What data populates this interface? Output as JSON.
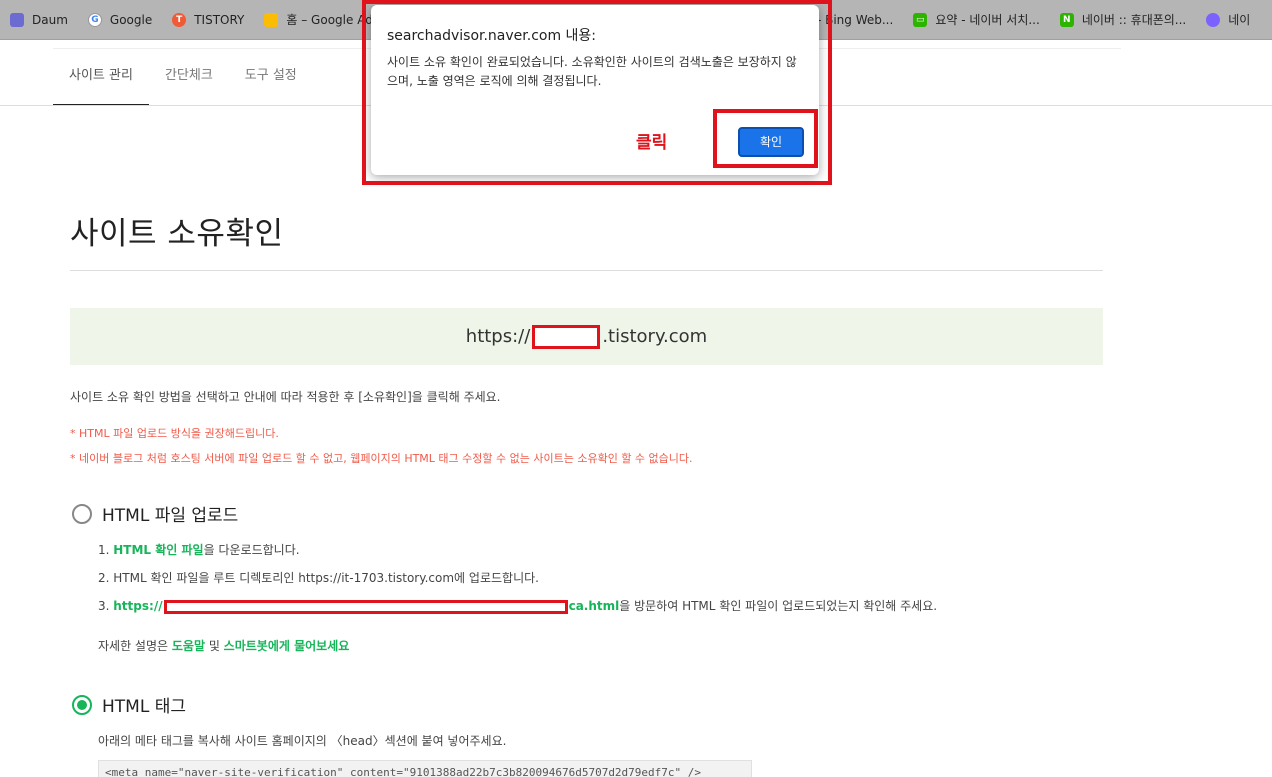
{
  "bookmarks": [
    {
      "label": "Daum",
      "icon": "daum-icon",
      "color": "#6b6bd1"
    },
    {
      "label": "Google",
      "icon": "google-icon",
      "color": "#4285f4"
    },
    {
      "label": "TISTORY",
      "icon": "tistory-icon",
      "color": "#f05a36"
    },
    {
      "label": "홈 – Google Ads",
      "icon": "google-ads-icon",
      "color": "#fbbc04"
    },
    {
      "label": "me - Bing Web...",
      "icon": "bing-icon",
      "color": "#9e9e9e"
    },
    {
      "label": "요약 - 네이버 서치...",
      "icon": "naver-search-icon",
      "color": "#2db400"
    },
    {
      "label": "네이버 :: 휴대폰의...",
      "icon": "naver-icon",
      "color": "#2db400"
    },
    {
      "label": "네이",
      "icon": "erp-icon",
      "color": "#7b61ff"
    }
  ],
  "tabs": [
    "사이트 관리",
    "간단체크",
    "도구 설정"
  ],
  "page": {
    "title": "사이트 소유확인",
    "url_prefix": "https://",
    "url_suffix": ".tistory.com",
    "desc": "사이트 소유 확인 방법을 선택하고 안내에 따라 적용한 후 [소유확인]을 클릭해 주세요.",
    "note1": "* HTML 파일 업로드 방식을 권장해드립니다.",
    "note2": "* 네이버 블로그 처럼 호스팅 서버에 파일 업로드 할 수 없고, 웹페이지의 HTML 태그 수정할 수 없는 사이트는 소유확인 할 수 없습니다."
  },
  "html_upload": {
    "label": "HTML 파일 업로드",
    "step1_prefix": "1. ",
    "step1_link": "HTML 확인 파일",
    "step1_rest": "을 다운로드합니다.",
    "step2": "2. HTML 확인 파일을 루트 디렉토리인 https://it-1703.tistory.com에 업로드합니다.",
    "step3_prefix": "3. ",
    "step3_link_start": "https://",
    "step3_link_end": "ca.html",
    "step3_rest": "을 방문하여 HTML 확인 파일이 업로드되었는지 확인해 주세요.",
    "help_prefix": "자세한 설명은 ",
    "help_link1": "도움말",
    "help_mid": " 및 ",
    "help_link2": "스마트봇에게 물어보세요"
  },
  "html_tag": {
    "label": "HTML 태그",
    "desc": "아래의 메타 태그를 복사해 사이트 홈페이지의 〈head〉섹션에 붙여 넣어주세요.",
    "meta": "<meta name=\"naver-site-verification\" content=\"9101388ad22b7c3b820094676d5707d2d79edf7c\" />"
  },
  "dialog": {
    "title": "searchadvisor.naver.com 내용:",
    "message": "사이트 소유 확인이 완료되었습니다. 소유확인한 사이트의 검색노출은 보장하지 않으며, 노출 영역은 로직에 의해 결정됩니다.",
    "ok_label": "확인"
  },
  "annotation": {
    "click_label": "클릭",
    "color": "#e0121b"
  }
}
